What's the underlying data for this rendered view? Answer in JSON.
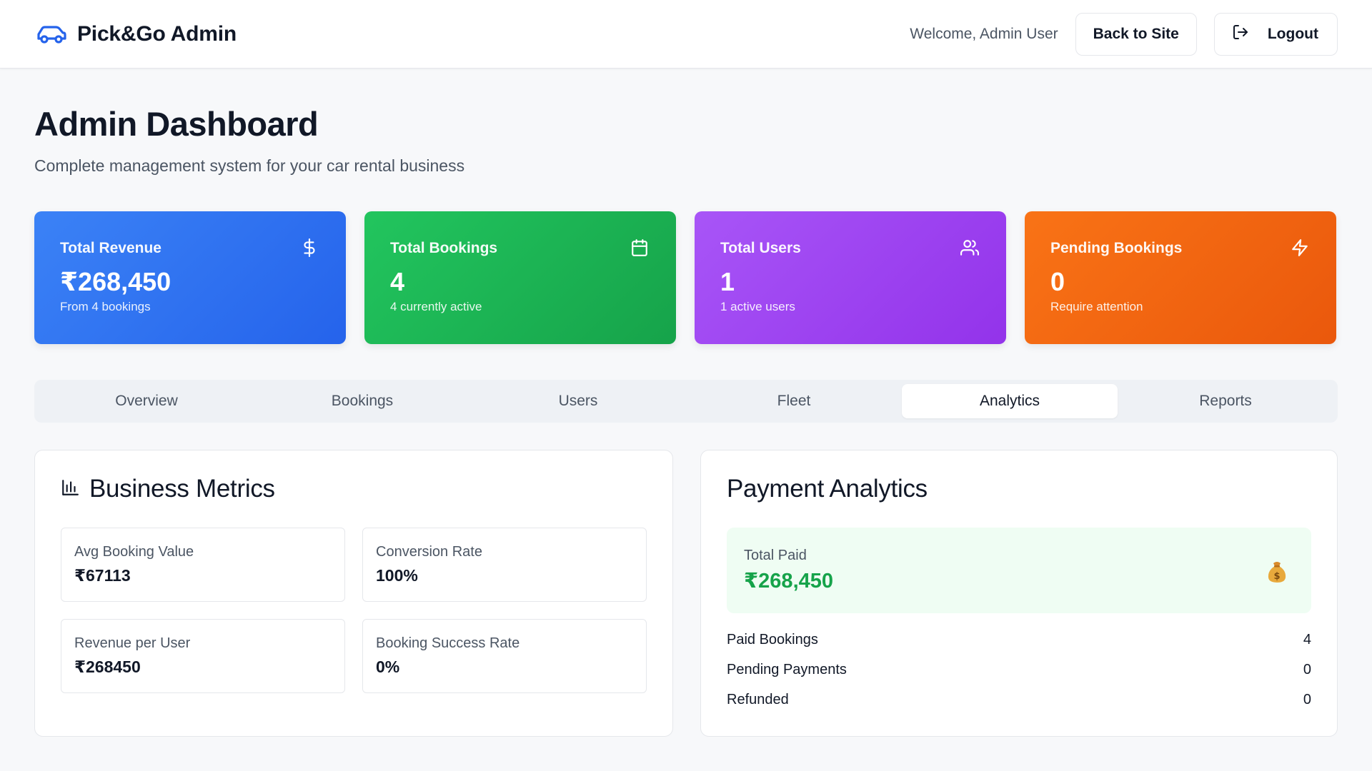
{
  "header": {
    "brand": "Pick&Go Admin",
    "welcome": "Welcome, Admin User",
    "back_label": "Back to Site",
    "logout_label": "Logout"
  },
  "page": {
    "title": "Admin Dashboard",
    "subtitle": "Complete management system for your car rental business"
  },
  "stats": [
    {
      "label": "Total Revenue",
      "value": "₹268,450",
      "sub": "From 4 bookings",
      "icon": "dollar-icon"
    },
    {
      "label": "Total Bookings",
      "value": "4",
      "sub": "4 currently active",
      "icon": "calendar-icon"
    },
    {
      "label": "Total Users",
      "value": "1",
      "sub": "1 active users",
      "icon": "users-icon"
    },
    {
      "label": "Pending Bookings",
      "value": "0",
      "sub": "Require attention",
      "icon": "bolt-icon"
    }
  ],
  "tabs": [
    {
      "label": "Overview"
    },
    {
      "label": "Bookings"
    },
    {
      "label": "Users"
    },
    {
      "label": "Fleet"
    },
    {
      "label": "Analytics",
      "active": true
    },
    {
      "label": "Reports"
    }
  ],
  "business_metrics": {
    "title": "Business Metrics",
    "items": [
      {
        "label": "Avg Booking Value",
        "value": "₹67113"
      },
      {
        "label": "Conversion Rate",
        "value": "100%"
      },
      {
        "label": "Revenue per User",
        "value": "₹268450"
      },
      {
        "label": "Booking Success Rate",
        "value": "0%"
      }
    ]
  },
  "payment_analytics": {
    "title": "Payment Analytics",
    "total_paid_label": "Total Paid",
    "total_paid_value": "₹268,450",
    "rows": [
      {
        "label": "Paid Bookings",
        "value": "4"
      },
      {
        "label": "Pending Payments",
        "value": "0"
      },
      {
        "label": "Refunded",
        "value": "0"
      }
    ]
  },
  "colors": {
    "brand": "#2563eb",
    "revenue": "#3b82f6",
    "bookings": "#22c55e",
    "users": "#a855f7",
    "pending": "#f97316",
    "paid_green": "#16a34a"
  }
}
